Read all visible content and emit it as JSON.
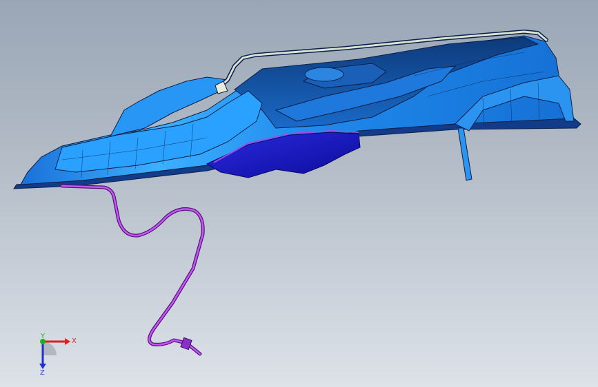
{
  "viewport": {
    "background_top": "#9aa6b6",
    "background_bottom": "#dde2e8"
  },
  "model": {
    "body_color": "#1f86e8",
    "body_highlight": "#3fb4ff",
    "body_dark": "#0b4fb8",
    "underside_color": "#1414c8",
    "edge_color": "#0a1f4a",
    "tube_color": "#b23de0",
    "rail_color": "#d9e3d2"
  },
  "triad": {
    "x_label": "X",
    "y_label": "Y",
    "z_label": "Z",
    "x_color": "#e02020",
    "y_color": "#20b020",
    "z_color": "#2030d0"
  }
}
